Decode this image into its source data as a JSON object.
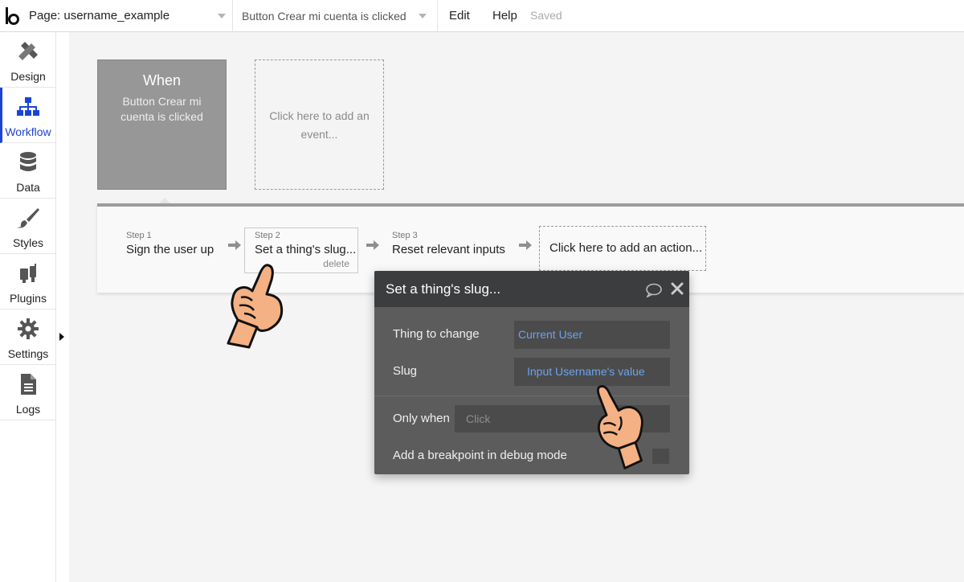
{
  "topbar": {
    "page_label": "Page: username_example",
    "event_label": "Button Crear mi cuenta is clicked",
    "menu_edit": "Edit",
    "menu_help": "Help",
    "saved_status": "Saved"
  },
  "sidebar": {
    "items": [
      {
        "label": "Design",
        "icon": "design-icon"
      },
      {
        "label": "Workflow",
        "icon": "workflow-icon",
        "active": true
      },
      {
        "label": "Data",
        "icon": "database-icon"
      },
      {
        "label": "Styles",
        "icon": "brush-icon"
      },
      {
        "label": "Plugins",
        "icon": "plugins-icon"
      },
      {
        "label": "Settings",
        "icon": "gear-icon"
      },
      {
        "label": "Logs",
        "icon": "document-icon"
      }
    ],
    "accent_color": "#1a44d6"
  },
  "event_card": {
    "title": "When",
    "description": "Button Crear mi cuenta is clicked"
  },
  "add_event": {
    "text": "Click here to add an event..."
  },
  "steps": [
    {
      "number": "Step 1",
      "name": "Sign the user up"
    },
    {
      "number": "Step 2",
      "name": "Set a thing's slug...",
      "delete_label": "delete"
    },
    {
      "number": "Step 3",
      "name": "Reset relevant inputs"
    }
  ],
  "add_action": {
    "text": "Click here to add an action..."
  },
  "popup": {
    "title": "Set a thing's slug...",
    "thing_to_change_label": "Thing to change",
    "thing_to_change_value": "Current User",
    "slug_label": "Slug",
    "slug_value": "Input Username's value",
    "only_when_label": "Only when",
    "only_when_placeholder": "Click",
    "breakpoint_label": "Add a breakpoint in debug mode",
    "value_color": "#6aa3ee"
  }
}
